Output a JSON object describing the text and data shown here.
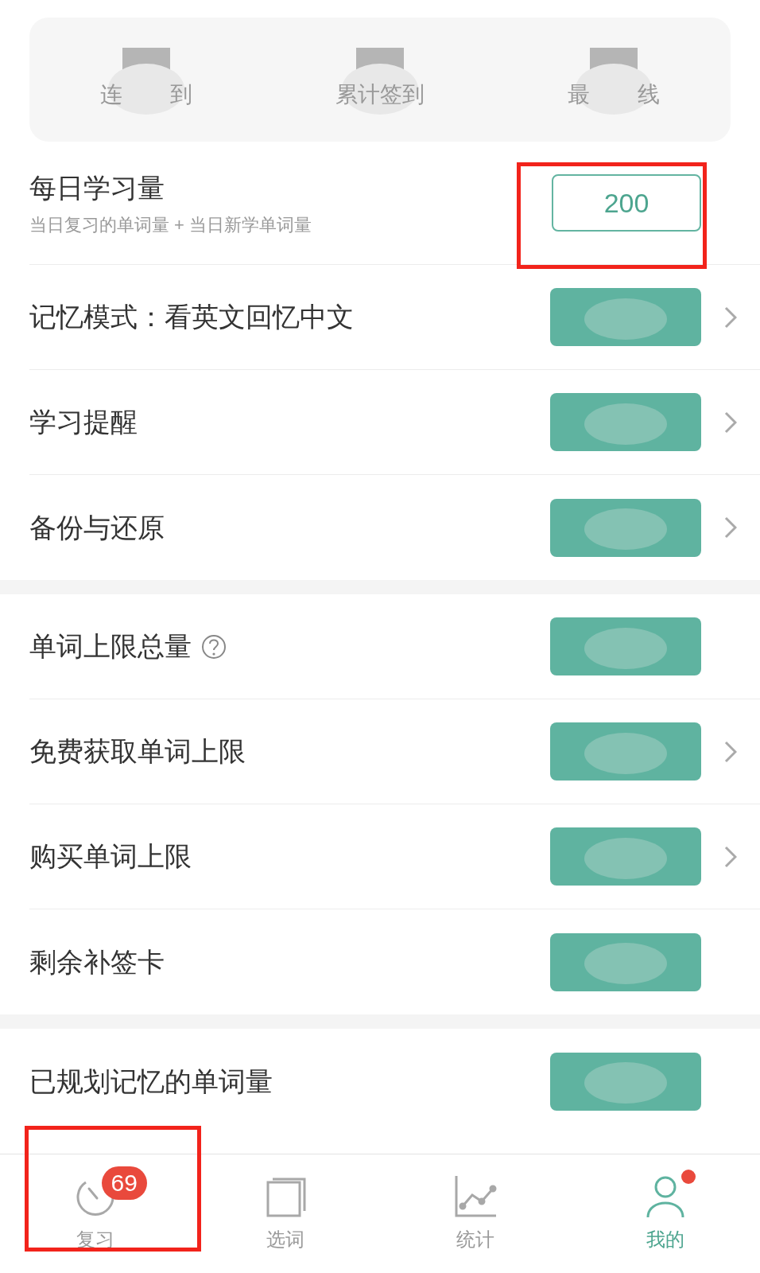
{
  "stats": [
    {
      "label_parts": [
        "连",
        "到"
      ]
    },
    {
      "label_parts": [
        "累计签到"
      ]
    },
    {
      "label_parts": [
        "最",
        "线"
      ]
    }
  ],
  "sections": [
    {
      "rows": [
        {
          "kind": "input",
          "label": "每日学习量",
          "subtitle": "当日复习的单词量 + 当日新学单词量",
          "value": "200",
          "chevron": false,
          "help": false,
          "annotated": true
        },
        {
          "kind": "value",
          "label": "记忆模式：看英文回忆中文",
          "chevron": true,
          "help": false,
          "annotated": false
        },
        {
          "kind": "value",
          "label": "学习提醒",
          "chevron": true,
          "help": false,
          "annotated": false
        },
        {
          "kind": "value",
          "label": "备份与还原",
          "chevron": true,
          "help": false,
          "annotated": false
        }
      ]
    },
    {
      "rows": [
        {
          "kind": "value",
          "label": "单词上限总量",
          "chevron": false,
          "help": true,
          "annotated": false
        },
        {
          "kind": "value",
          "label": "免费获取单词上限",
          "chevron": true,
          "help": false,
          "annotated": false
        },
        {
          "kind": "value",
          "label": "购买单词上限",
          "chevron": true,
          "help": false,
          "annotated": false
        },
        {
          "kind": "value",
          "label": "剩余补签卡",
          "chevron": false,
          "help": false,
          "annotated": false
        }
      ]
    },
    {
      "rows": [
        {
          "kind": "value",
          "label": "已规划记忆的单词量",
          "chevron": false,
          "help": false,
          "annotated": false
        }
      ]
    }
  ],
  "tabs": [
    {
      "kind": "review",
      "label": "复习",
      "selected": false,
      "badge": "69",
      "dot": false,
      "annotated": true
    },
    {
      "kind": "words",
      "label": "选词",
      "selected": false,
      "dot": false,
      "annotated": false
    },
    {
      "kind": "stats",
      "label": "统计",
      "selected": false,
      "dot": false,
      "annotated": false
    },
    {
      "kind": "me",
      "label": "我的",
      "selected": true,
      "dot": true,
      "annotated": false
    }
  ]
}
